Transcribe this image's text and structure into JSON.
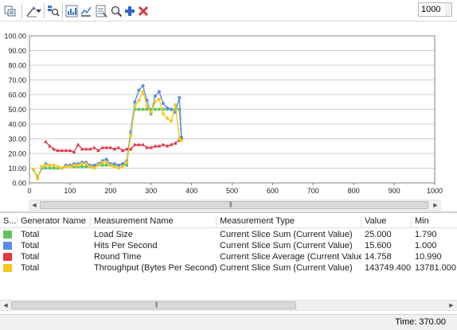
{
  "toolbar": {
    "buttons": [
      {
        "name": "copy-graph-button",
        "icon": "copy-icon"
      },
      {
        "name": "graph-options-button",
        "icon": "graph-options-icon"
      },
      {
        "name": "graph-options-dropdown",
        "icon": "chevron-down-icon"
      },
      {
        "name": "find-button",
        "icon": "find-icon"
      },
      {
        "name": "counter-chart-button",
        "icon": "chart-icon"
      },
      {
        "name": "show-hide-counters-button",
        "icon": "counters-icon"
      },
      {
        "name": "properties-button",
        "icon": "properties-icon"
      },
      {
        "name": "zoom-button",
        "icon": "zoom-icon"
      },
      {
        "name": "add-counter-button",
        "icon": "plus-icon"
      },
      {
        "name": "delete-counter-button",
        "icon": "delete-icon"
      }
    ],
    "interval_value": "1000"
  },
  "colors": {
    "load_size": "#5ec45e",
    "hits_per_second": "#5b8ee6",
    "round_time": "#e23745",
    "throughput": "#f7c61d",
    "grid": "#d0d0d0",
    "axis": "#808080"
  },
  "chart_data": {
    "type": "line",
    "ylim": [
      0,
      100
    ],
    "xlim": [
      0,
      1000
    ],
    "y_ticks": [
      "0.00",
      "10.00",
      "20.00",
      "30.00",
      "40.00",
      "50.00",
      "60.00",
      "70.00",
      "80.00",
      "90.00",
      "100.00"
    ],
    "x_ticks": [
      "0",
      "100",
      "200",
      "300",
      "400",
      "500",
      "600",
      "700",
      "800",
      "900",
      "1000"
    ],
    "grid": "horizontal",
    "series": [
      {
        "color": "#5ec45e",
        "points": [
          [
            10,
            9
          ],
          [
            20,
            4
          ],
          [
            30,
            10
          ],
          [
            40,
            10
          ],
          [
            50,
            10
          ],
          [
            60,
            10
          ],
          [
            70,
            10
          ],
          [
            80,
            10
          ],
          [
            90,
            11
          ],
          [
            100,
            11
          ],
          [
            110,
            11
          ],
          [
            120,
            11
          ],
          [
            130,
            11
          ],
          [
            140,
            11
          ],
          [
            150,
            11
          ],
          [
            160,
            12
          ],
          [
            170,
            12
          ],
          [
            180,
            12
          ],
          [
            190,
            12
          ],
          [
            200,
            12
          ],
          [
            210,
            12
          ],
          [
            220,
            12
          ],
          [
            230,
            12
          ],
          [
            240,
            12
          ],
          [
            250,
            34
          ],
          [
            260,
            50
          ],
          [
            270,
            50
          ],
          [
            280,
            50
          ],
          [
            290,
            50
          ],
          [
            300,
            50
          ],
          [
            310,
            50
          ],
          [
            320,
            50
          ],
          [
            330,
            50
          ],
          [
            340,
            50
          ],
          [
            350,
            50
          ],
          [
            360,
            50
          ],
          [
            370,
            50
          ],
          [
            375,
            30
          ]
        ]
      },
      {
        "color": "#5b8ee6",
        "points": [
          [
            10,
            9
          ],
          [
            20,
            3
          ],
          [
            30,
            10
          ],
          [
            40,
            13
          ],
          [
            50,
            12
          ],
          [
            60,
            12
          ],
          [
            70,
            11
          ],
          [
            80,
            10
          ],
          [
            90,
            12
          ],
          [
            100,
            12
          ],
          [
            110,
            13
          ],
          [
            120,
            13
          ],
          [
            130,
            14
          ],
          [
            140,
            14
          ],
          [
            150,
            12
          ],
          [
            160,
            12
          ],
          [
            170,
            13
          ],
          [
            180,
            15
          ],
          [
            190,
            16
          ],
          [
            200,
            13
          ],
          [
            210,
            13
          ],
          [
            220,
            12
          ],
          [
            230,
            13
          ],
          [
            240,
            15
          ],
          [
            250,
            35
          ],
          [
            260,
            55
          ],
          [
            270,
            63
          ],
          [
            280,
            66
          ],
          [
            290,
            56
          ],
          [
            300,
            47
          ],
          [
            310,
            59
          ],
          [
            320,
            62
          ],
          [
            330,
            54
          ],
          [
            340,
            51
          ],
          [
            350,
            50
          ],
          [
            360,
            48
          ],
          [
            370,
            58
          ],
          [
            375,
            31
          ]
        ]
      },
      {
        "color": "#e23745",
        "points": [
          [
            40,
            28
          ],
          [
            50,
            25
          ],
          [
            60,
            23
          ],
          [
            70,
            22
          ],
          [
            80,
            22
          ],
          [
            90,
            22
          ],
          [
            100,
            22
          ],
          [
            110,
            21
          ],
          [
            120,
            26
          ],
          [
            130,
            23
          ],
          [
            140,
            23
          ],
          [
            150,
            23
          ],
          [
            160,
            24
          ],
          [
            170,
            22
          ],
          [
            180,
            24
          ],
          [
            190,
            24
          ],
          [
            200,
            24
          ],
          [
            210,
            23
          ],
          [
            220,
            24
          ],
          [
            230,
            22
          ],
          [
            240,
            23
          ],
          [
            250,
            23
          ],
          [
            260,
            26
          ],
          [
            270,
            26
          ],
          [
            280,
            26
          ],
          [
            290,
            24
          ],
          [
            300,
            24
          ],
          [
            310,
            25
          ],
          [
            320,
            25
          ],
          [
            330,
            26
          ],
          [
            340,
            25
          ],
          [
            350,
            26
          ],
          [
            360,
            27
          ],
          [
            370,
            29
          ],
          [
            375,
            30
          ]
        ]
      },
      {
        "color": "#f7c61d",
        "points": [
          [
            10,
            9
          ],
          [
            20,
            3
          ],
          [
            30,
            11
          ],
          [
            40,
            12
          ],
          [
            50,
            12
          ],
          [
            60,
            12
          ],
          [
            70,
            11
          ],
          [
            80,
            10
          ],
          [
            90,
            11
          ],
          [
            100,
            11
          ],
          [
            110,
            12
          ],
          [
            120,
            12
          ],
          [
            130,
            13
          ],
          [
            140,
            13
          ],
          [
            150,
            11
          ],
          [
            160,
            10
          ],
          [
            170,
            12
          ],
          [
            180,
            14
          ],
          [
            190,
            14
          ],
          [
            200,
            12
          ],
          [
            210,
            11
          ],
          [
            220,
            10
          ],
          [
            230,
            11
          ],
          [
            240,
            14
          ],
          [
            250,
            32
          ],
          [
            260,
            52
          ],
          [
            270,
            56
          ],
          [
            280,
            62
          ],
          [
            290,
            52
          ],
          [
            300,
            48
          ],
          [
            310,
            55
          ],
          [
            320,
            57
          ],
          [
            330,
            47
          ],
          [
            340,
            44
          ],
          [
            350,
            42
          ],
          [
            360,
            53
          ],
          [
            370,
            30
          ],
          [
            375,
            29
          ]
        ]
      }
    ]
  },
  "table": {
    "columns": [
      "S...",
      "Generator Name",
      "Measurement Name",
      "Measurement Type",
      "Value",
      "Min"
    ],
    "rows": [
      {
        "color": "#5ec45e",
        "generator": "Total",
        "measurement": "Load Size",
        "type": "Current Slice Sum (Current Value)",
        "value": "25.000",
        "min": "1.790"
      },
      {
        "color": "#5b8ee6",
        "generator": "Total",
        "measurement": "Hits Per Second",
        "type": "Current Slice Sum (Current Value)",
        "value": "15.600",
        "min": "1.000"
      },
      {
        "color": "#e23745",
        "generator": "Total",
        "measurement": "Round Time",
        "type": "Current Slice Average (Current Value)",
        "value": "14.758",
        "min": "10.990"
      },
      {
        "color": "#f7c61d",
        "generator": "Total",
        "measurement": "Throughput (Bytes Per Second)",
        "type": "Current Slice Sum (Current Value)",
        "value": "143749.400",
        "min": "13781.000"
      }
    ]
  },
  "status": {
    "time": "Time: 370.00"
  }
}
